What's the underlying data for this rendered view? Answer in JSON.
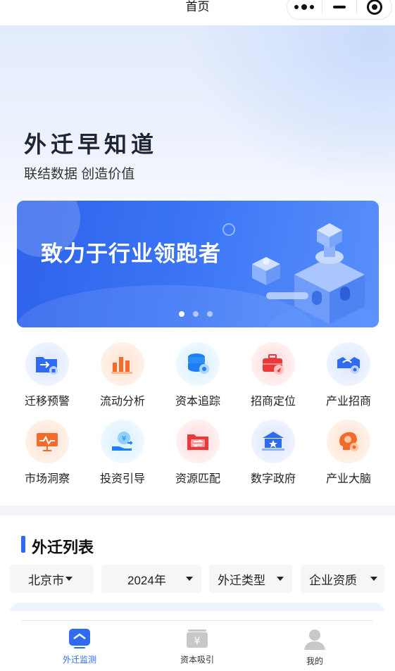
{
  "navbar": {
    "title": "首页"
  },
  "hero": {
    "title": "外迁早知道",
    "subtitle": "联结数据 创造价值"
  },
  "banner": {
    "text": "致力于行业领跑者",
    "slide_count": 3,
    "active_slide": 1
  },
  "features": [
    {
      "label": "迁移预警",
      "icon": "folder-transfer-icon"
    },
    {
      "label": "流动分析",
      "icon": "bar-chart-icon"
    },
    {
      "label": "资本追踪",
      "icon": "database-icon"
    },
    {
      "label": "招商定位",
      "icon": "briefcase-location-icon"
    },
    {
      "label": "产业招商",
      "icon": "handshake-icon"
    },
    {
      "label": "市场洞察",
      "icon": "presentation-board-icon"
    },
    {
      "label": "投资引导",
      "icon": "investment-hand-icon"
    },
    {
      "label": "资源匹配",
      "icon": "folder-exchange-icon"
    },
    {
      "label": "数字政府",
      "icon": "government-building-icon"
    },
    {
      "label": "产业大脑",
      "icon": "brain-gear-icon"
    }
  ],
  "list": {
    "title": "外迁列表",
    "filters": [
      {
        "value": "北京市"
      },
      {
        "value": "2024年"
      },
      {
        "value": "外迁类型"
      },
      {
        "value": "企业资质"
      }
    ]
  },
  "tabbar": {
    "items": [
      {
        "label": "外迁监测",
        "icon": "monitor-icon",
        "active": true
      },
      {
        "label": "资本吸引",
        "icon": "yuan-box-icon",
        "active": false
      },
      {
        "label": "我的",
        "icon": "user-icon",
        "active": false
      }
    ]
  },
  "colors": {
    "accent": "#2f6bf0",
    "banner": "#3a74f5",
    "orange": "#f26b2a",
    "red": "#e83a3a"
  }
}
